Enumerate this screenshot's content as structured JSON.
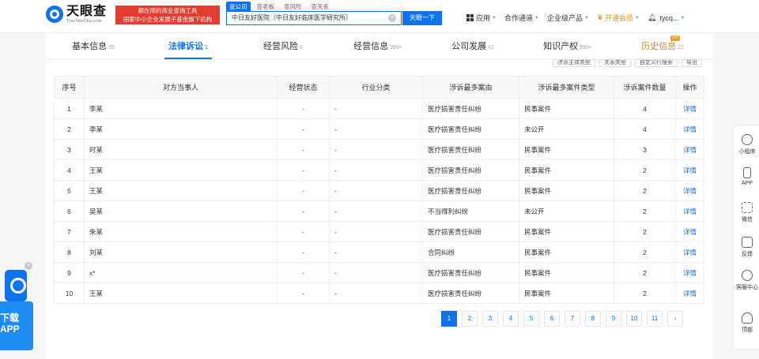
{
  "header": {
    "logo_cn": "天眼查",
    "logo_en": "TianYanCha.com",
    "slogan_line1": "都在用的商业查询工具",
    "slogan_line2": "国家中小企业发展子基金旗下机构",
    "search_tabs": [
      "查公司",
      "查老板",
      "查风险",
      "查关系"
    ],
    "search_value": "中日友好医院（中日友好临床医学研究所）",
    "search_button": "天眼一下",
    "nav": {
      "apps": "应用",
      "cooperation": "合作通道",
      "enterprise": "企业级产品",
      "vip": "开通会员",
      "user": "tycq..."
    }
  },
  "tabs": [
    {
      "label": "基本信息",
      "count": "35"
    },
    {
      "label": "法律诉讼",
      "count": "1"
    },
    {
      "label": "经营风险",
      "count": "8"
    },
    {
      "label": "经营信息",
      "count": "999+"
    },
    {
      "label": "公司发展",
      "count": "42"
    },
    {
      "label": "知识产权",
      "count": "999+"
    },
    {
      "label": "历史信息",
      "count": "22"
    }
  ],
  "vip_badge": "VIP",
  "filters": [
    "涉诉主体类型",
    "关系类型",
    "自定义行搜索",
    "导出"
  ],
  "table": {
    "headers": [
      "序号",
      "对方当事人",
      "经营状态",
      "行业分类",
      "涉诉最多案由",
      "涉诉最多案件类型",
      "涉诉案件数量",
      "操作"
    ],
    "rows": [
      [
        "1",
        "李某",
        "-",
        "-",
        "医疗损害责任纠纷",
        "民事案件",
        "4",
        "详情"
      ],
      [
        "2",
        "李某",
        "-",
        "-",
        "医疗损害责任纠纷",
        "未公开",
        "4",
        "详情"
      ],
      [
        "3",
        "时某",
        "-",
        "-",
        "医疗损害责任纠纷",
        "民事案件",
        "3",
        "详情"
      ],
      [
        "4",
        "王某",
        "-",
        "-",
        "医疗损害责任纠纷",
        "民事案件",
        "2",
        "详情"
      ],
      [
        "5",
        "王某",
        "-",
        "-",
        "医疗损害责任纠纷",
        "民事案件",
        "2",
        "详情"
      ],
      [
        "6",
        "吴某",
        "-",
        "-",
        "不当得利纠纷",
        "未公开",
        "2",
        "详情"
      ],
      [
        "7",
        "朱某",
        "-",
        "-",
        "医疗损害责任纠纷",
        "民事案件",
        "2",
        "详情"
      ],
      [
        "8",
        "刘某",
        "-",
        "-",
        "合同纠纷",
        "民事案件",
        "2",
        "详情"
      ],
      [
        "9",
        "x*",
        "-",
        "-",
        "医疗损害责任纠纷",
        "民事案件",
        "2",
        "详情"
      ],
      [
        "10",
        "王某",
        "-",
        "-",
        "医疗损害责任纠纷",
        "民事案件",
        "2",
        "详情"
      ]
    ]
  },
  "pagination": {
    "pages": [
      "1",
      "2",
      "3",
      "4",
      "5",
      "6",
      "7",
      "8",
      "9",
      "10",
      "11"
    ],
    "current": "1",
    "next": "›"
  },
  "rail": [
    "小程序",
    "APP",
    "微信",
    "反馈",
    "客服中心",
    "顶部"
  ],
  "download": {
    "label_line1": "下载",
    "label_line2": "APP",
    "close": "×"
  },
  "colors": {
    "brand": "#0f73ee",
    "slogan_bg": "#e43c2f",
    "vip": "#e08a00"
  }
}
